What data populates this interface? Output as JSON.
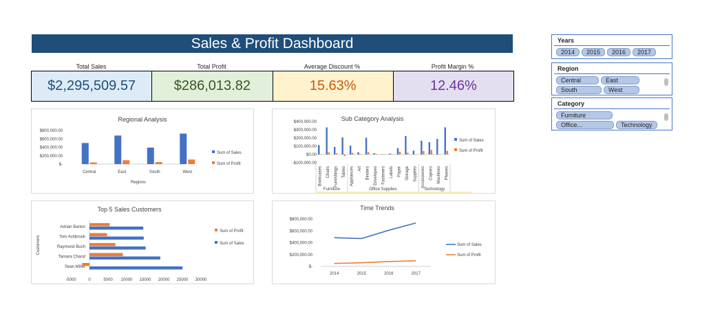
{
  "dashboard": {
    "title": "Sales & Profit Dashboard"
  },
  "kpis": [
    {
      "label": "Total Sales",
      "value": "$2,295,509.57",
      "bg": "#ddebf7",
      "color": "#1f4e79"
    },
    {
      "label": "Total Profit",
      "value": "$286,013.82",
      "bg": "#e2efda",
      "color": "#375623"
    },
    {
      "label": "Average Discount %",
      "value": "15.63%",
      "bg": "#fff2cc",
      "color": "#c65911"
    },
    {
      "label": "Profit Margin %",
      "value": "12.46%",
      "bg": "#e4dff0",
      "color": "#7030a0"
    }
  ],
  "colors": {
    "sales": "#4472c4",
    "profit": "#ed7d31",
    "title_bar": "#1f4e79"
  },
  "slicers": {
    "years": {
      "title": "Years",
      "items": [
        "2014",
        "2015",
        "2016",
        "2017"
      ]
    },
    "region": {
      "title": "Region",
      "items": [
        "Central",
        "East",
        "South",
        "West"
      ]
    },
    "category": {
      "title": "Category",
      "items": [
        "Furniture",
        "Office...",
        "Technology"
      ]
    }
  },
  "chart_data": [
    {
      "type": "bar",
      "title": "Regional Analysis",
      "xlabel": "Regions",
      "categories": [
        "Central",
        "East",
        "South",
        "West"
      ],
      "series": [
        {
          "name": "Sum of Sales",
          "values": [
            501240,
            678781,
            391722,
            725458
          ]
        },
        {
          "name": "Sum of Profit",
          "values": [
            39706,
            91523,
            46749,
            108418
          ]
        }
      ],
      "ylim": [
        0,
        800000
      ],
      "yticks": [
        "$-",
        "$200,000.00",
        "$400,000.00",
        "$600,000.00",
        "$800,000.00"
      ],
      "legend": "right"
    },
    {
      "type": "bar",
      "title": "Sub Category Analysis",
      "groups": [
        {
          "name": "Furniture",
          "categories": [
            "Bookcases",
            "Chairs",
            "Furnishings",
            "Tables"
          ]
        },
        {
          "name": "Office Supplies",
          "categories": [
            "Appliances",
            "Art",
            "Binders",
            "Envelopes",
            "Fasteners",
            "Labels",
            "Paper",
            "Storage",
            "Supplies"
          ]
        },
        {
          "name": "Technology",
          "categories": [
            "Accessories",
            "Copiers",
            "Machines",
            "Phones"
          ]
        }
      ],
      "series": [
        {
          "name": "Sum of Sales",
          "values": [
            114880,
            328449,
            91705,
            206966,
            107532,
            27119,
            203413,
            16476,
            3024,
            12486,
            78479,
            223844,
            46674,
            167380,
            149528,
            189239,
            330007
          ]
        },
        {
          "name": "Sum of Profit",
          "values": [
            -3473,
            26590,
            13059,
            -17725,
            18138,
            6528,
            30222,
            6964,
            950,
            5546,
            34054,
            21279,
            -1189,
            41937,
            55618,
            3385,
            44516
          ]
        }
      ],
      "ylim": [
        -100000,
        400000
      ],
      "yticks": [
        "-$100,000.00",
        "$0.00",
        "$100,000.00",
        "$200,000.00",
        "$300,000.00",
        "$400,000.00"
      ],
      "legend": "right"
    },
    {
      "type": "bar",
      "orientation": "horizontal",
      "title": "Top 5 Sales Customers",
      "ylabel": "Customers",
      "categories": [
        "Adrian Barton",
        "Tom Ashbrook",
        "Raymond Buch",
        "Tamara Chand",
        "Sean Miller"
      ],
      "series": [
        {
          "name": "Sum of Profit",
          "values": [
            5444,
            4704,
            6976,
            8981,
            -1980
          ]
        },
        {
          "name": "Sum of Sales",
          "values": [
            14474,
            14596,
            15117,
            19052,
            25043
          ]
        }
      ],
      "xlim": [
        -5000,
        30000
      ],
      "xticks": [
        "-5000",
        "0",
        "5000",
        "10000",
        "15000",
        "20000",
        "25000",
        "30000"
      ],
      "legend": "right"
    },
    {
      "type": "line",
      "title": "Time Trends",
      "x": [
        "2014",
        "2015",
        "2016",
        "2017"
      ],
      "series": [
        {
          "name": "Sum of Sales",
          "values": [
            484247,
            470533,
            609206,
            733215
          ]
        },
        {
          "name": "Sum of Profit",
          "values": [
            49544,
            61619,
            81795,
            93439
          ]
        }
      ],
      "ylim": [
        0,
        800000
      ],
      "yticks": [
        "$-",
        "$200,000.00",
        "$400,000.00",
        "$600,000.00",
        "$800,000.00"
      ],
      "legend": "right"
    }
  ]
}
